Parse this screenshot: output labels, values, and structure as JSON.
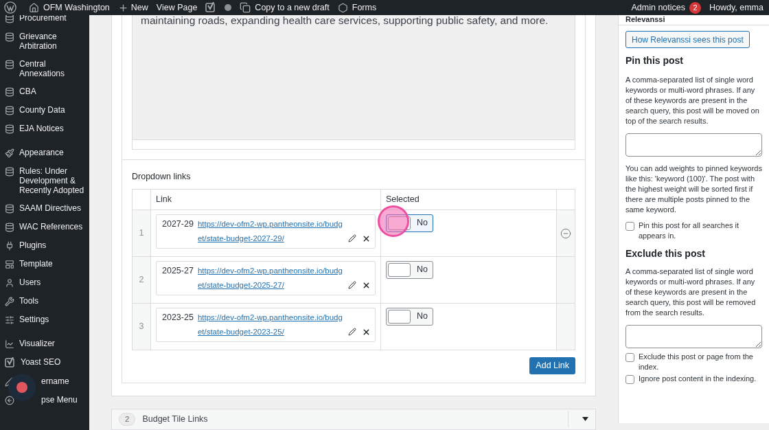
{
  "admin_bar": {
    "site_name": "OFM Washington",
    "new": "New",
    "view_page": "View Page",
    "copy_draft": "Copy to a new draft",
    "forms": "Forms",
    "notices": "Admin notices",
    "notice_count": "2",
    "greeting": "Howdy, emma"
  },
  "sidebar": {
    "groups": [
      {
        "items": [
          {
            "label": "Procurement"
          },
          {
            "label": "Grievance Arbitration"
          },
          {
            "label": "Central Annexations"
          },
          {
            "label": "CBA"
          },
          {
            "label": "County Data"
          },
          {
            "label": "EJA Notices"
          }
        ]
      },
      {
        "items": [
          {
            "label": "Appearance"
          },
          {
            "label": "Rules: Under Development & Recently Adopted"
          },
          {
            "label": "SAAM Directives"
          },
          {
            "label": "WAC References"
          },
          {
            "label": "Plugins"
          },
          {
            "label": "Template"
          },
          {
            "label": "Users"
          },
          {
            "label": "Tools"
          },
          {
            "label": "Settings"
          }
        ]
      },
      {
        "items": [
          {
            "label": "Visualizer"
          },
          {
            "label": "Yoast SEO"
          },
          {
            "label": "ername"
          },
          {
            "label": "pse Menu"
          }
        ]
      }
    ]
  },
  "editor": {
    "text": "maintaining roads, expanding health care services, supporting public safety, and more."
  },
  "dropdown_links": {
    "title": "Dropdown links",
    "columns": [
      "Link",
      "Selected"
    ],
    "rows": [
      {
        "number": "1",
        "year": "2027-29",
        "url": "https://dev-ofm2-wp.pantheonsite.io/budget/state-budget-2027-29/",
        "toggle_label": "No",
        "on": false,
        "focused": true,
        "hovered": true
      },
      {
        "number": "2",
        "year": "2025-27",
        "url": "https://dev-ofm2-wp.pantheonsite.io/budget/state-budget-2025-27/",
        "toggle_label": "No",
        "on": false,
        "focused": false,
        "hovered": false
      },
      {
        "number": "3",
        "year": "2023-25",
        "url": "https://dev-ofm2-wp.pantheonsite.io/budget/state-budget-2023-25/",
        "toggle_label": "No",
        "on": false,
        "focused": false,
        "hovered": false
      }
    ],
    "add_button": "Add Link"
  },
  "collapsed_section": {
    "number": "2",
    "title": "Budget Tile Links",
    "expanded": false
  },
  "relevanssi": {
    "title": "Relevanssi",
    "preview_button": "How Relevanssi sees this post",
    "pin": {
      "heading": "Pin this post",
      "description": "A comma-separated list of single word keywords or multi-word phrases. If any of these keywords are present in the search query, this post will be moved on top of the search results.",
      "hint": "You can add weights to pinned keywords like this: 'keyword (100)'. The post with the highest weight will be sorted first if there are multiple posts pinned to the same keyword.",
      "checkboxes": [
        {
          "label": "Pin this post for all searches it appears in.",
          "checked": false
        }
      ]
    },
    "exclude": {
      "heading": "Exclude this post",
      "description": "A comma-separated list of single word keywords or multi-word phrases. If any of these keywords are present in the search query, this post will be removed from the search results.",
      "checkboxes": [
        {
          "label": "Exclude this post or page from the index.",
          "checked": false
        },
        {
          "label": "Ignore post content in the indexing.",
          "checked": false
        }
      ]
    }
  }
}
